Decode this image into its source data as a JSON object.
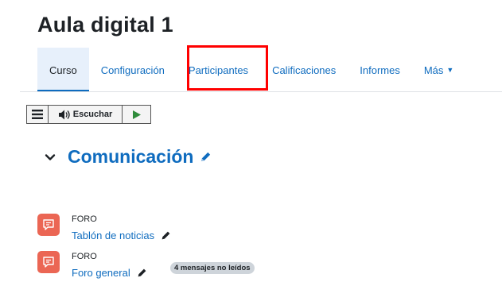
{
  "course": {
    "title": "Aula digital 1"
  },
  "nav": {
    "tabs": [
      {
        "label": "Curso",
        "active": true
      },
      {
        "label": "Configuración"
      },
      {
        "label": "Participantes",
        "highlighted": true
      },
      {
        "label": "Calificaciones"
      },
      {
        "label": "Informes"
      },
      {
        "label": "Más"
      }
    ]
  },
  "tts": {
    "menu_icon": "hamburger-icon",
    "listen_icon": "speaker-icon",
    "listen_label": "Escuchar",
    "play_icon": "play-icon"
  },
  "section": {
    "title": "Comunicación"
  },
  "activities": [
    {
      "type": "FORO",
      "name": "Tablón de noticias",
      "icon": "forum-icon"
    },
    {
      "type": "FORO",
      "name": "Foro general",
      "icon": "forum-icon",
      "badge": "4 mensajes no leídos"
    }
  ],
  "colors": {
    "link": "#0f6cbf",
    "forum_icon_bg": "#eb6654",
    "active_tab_bg": "#e7f0fb",
    "highlight": "#ff0000"
  }
}
